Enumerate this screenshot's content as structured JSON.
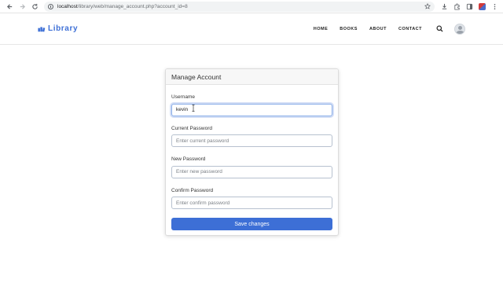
{
  "browser": {
    "url_host": "localhost",
    "url_path": "/library/web/manage_account.php?account_id=8"
  },
  "header": {
    "logo_text": "Library",
    "logo_icon": "books-icon",
    "nav": [
      {
        "label": "HOME"
      },
      {
        "label": "BOOKS"
      },
      {
        "label": "ABOUT"
      },
      {
        "label": "CONTACT"
      }
    ],
    "search_icon": "search-icon",
    "avatar_icon": "user-avatar"
  },
  "form": {
    "title": "Manage Account",
    "username": {
      "label": "Username",
      "value": "kevin"
    },
    "current_password": {
      "label": "Current Password",
      "placeholder": "Enter current password"
    },
    "new_password": {
      "label": "New Password",
      "placeholder": "Enter new password"
    },
    "confirm_password": {
      "label": "Confirm Password",
      "placeholder": "Enter confirm password"
    },
    "submit_label": "Save changes"
  },
  "colors": {
    "accent": "#3d6fd6",
    "card_header_bg": "#f7f7f7"
  }
}
